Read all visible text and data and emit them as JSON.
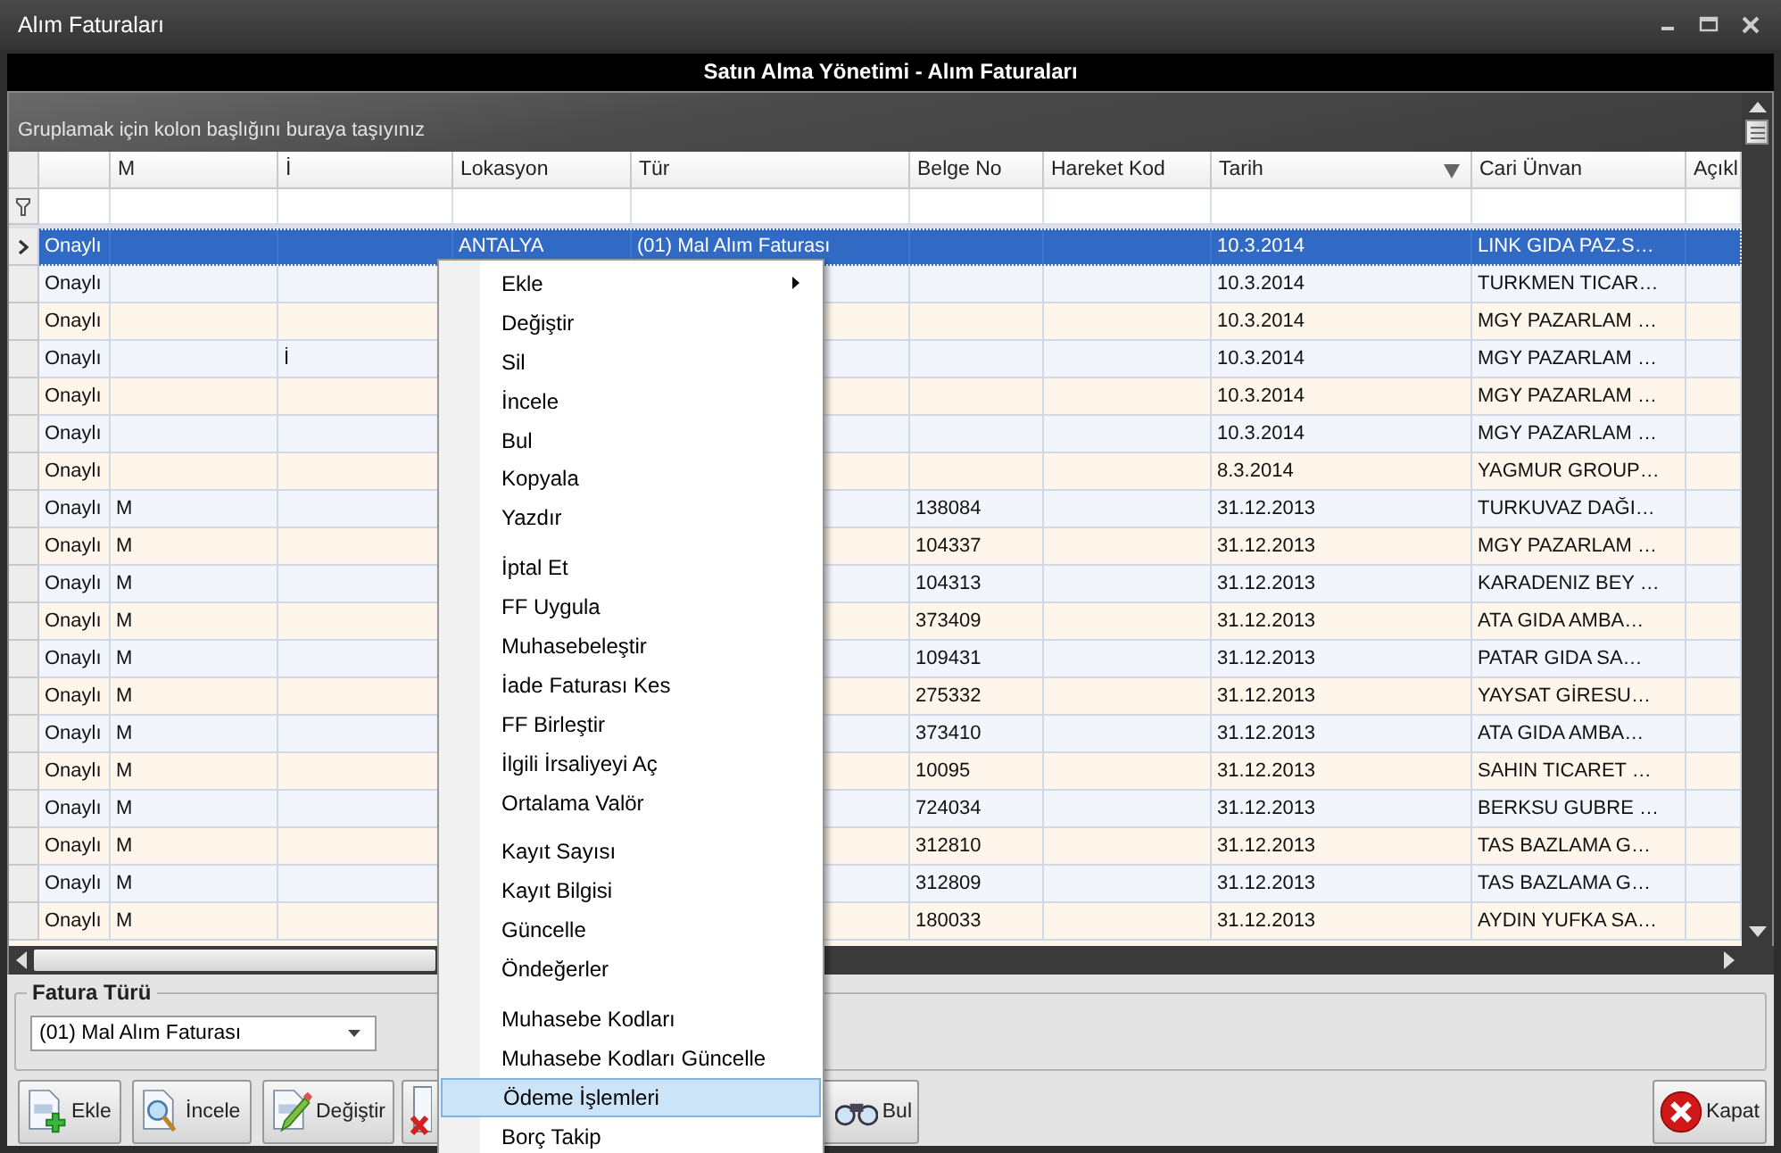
{
  "window": {
    "title": "Alım Faturaları"
  },
  "header_title": "Satın Alma Yönetimi - Alım Faturaları",
  "group_panel_hint": "Gruplamak için kolon başlığını buraya taşıyınız",
  "table": {
    "columns": [
      {
        "sorted": false
      },
      {
        "label": "M",
        "sorted": false
      },
      {
        "label": "İ",
        "sorted": false
      },
      {
        "label": "Lokasyon",
        "sorted": false
      },
      {
        "label": "Tür",
        "sorted": false
      },
      {
        "label": "Belge No",
        "sorted": false
      },
      {
        "label": "Hareket Kod",
        "sorted": false
      },
      {
        "label": "Tarih",
        "sorted": true
      },
      {
        "label": "Cari Ünvan",
        "sorted": false
      },
      {
        "label": "Açıkl",
        "sorted": false
      }
    ],
    "rows": [
      {
        "selected": true,
        "cells": [
          "Onaylı",
          "",
          "",
          "ANTALYA",
          "(01) Mal Alım Faturası",
          "",
          "",
          "10.3.2014",
          "LINK GIDA PAZ.S…"
        ]
      },
      {
        "selected": false,
        "cells": [
          "Onaylı",
          "",
          "",
          "",
          "",
          "",
          "",
          "10.3.2014",
          "TURKMEN TICAR…"
        ]
      },
      {
        "selected": false,
        "cells": [
          "Onaylı",
          "",
          "",
          "",
          "",
          "",
          "",
          "10.3.2014",
          "MGY PAZARLAM …"
        ]
      },
      {
        "selected": false,
        "cells": [
          "Onaylı",
          "",
          "İ",
          "",
          "",
          "",
          "",
          "10.3.2014",
          "MGY PAZARLAM …"
        ]
      },
      {
        "selected": false,
        "cells": [
          "Onaylı",
          "",
          "",
          "",
          "",
          "",
          "",
          "10.3.2014",
          "MGY PAZARLAM …"
        ]
      },
      {
        "selected": false,
        "cells": [
          "Onaylı",
          "",
          "",
          "",
          "",
          "",
          "",
          "10.3.2014",
          "MGY PAZARLAM …"
        ]
      },
      {
        "selected": false,
        "cells": [
          "Onaylı",
          "",
          "",
          "",
          "",
          "",
          "",
          "8.3.2014",
          "YAGMUR GROUP…"
        ]
      },
      {
        "selected": false,
        "cells": [
          "Onaylı",
          "M",
          "",
          "",
          "",
          "138084",
          "",
          "31.12.2013",
          "TURKUVAZ DAĞI…"
        ]
      },
      {
        "selected": false,
        "cells": [
          "Onaylı",
          "M",
          "",
          "",
          "",
          "104337",
          "",
          "31.12.2013",
          "MGY PAZARLAM …"
        ]
      },
      {
        "selected": false,
        "cells": [
          "Onaylı",
          "M",
          "",
          "",
          "",
          "104313",
          "",
          "31.12.2013",
          "KARADENIZ BEY …"
        ]
      },
      {
        "selected": false,
        "cells": [
          "Onaylı",
          "M",
          "",
          "",
          "",
          "373409",
          "",
          "31.12.2013",
          "ATA GIDA AMBA…"
        ]
      },
      {
        "selected": false,
        "cells": [
          "Onaylı",
          "M",
          "",
          "",
          "",
          "109431",
          "",
          "31.12.2013",
          "PATAR GIDA SA…"
        ]
      },
      {
        "selected": false,
        "cells": [
          "Onaylı",
          "M",
          "",
          "",
          "",
          "275332",
          "",
          "31.12.2013",
          "YAYSAT GİRESU…"
        ]
      },
      {
        "selected": false,
        "cells": [
          "Onaylı",
          "M",
          "",
          "",
          "",
          "373410",
          "",
          "31.12.2013",
          "ATA GIDA AMBA…"
        ]
      },
      {
        "selected": false,
        "cells": [
          "Onaylı",
          "M",
          "",
          "",
          "",
          "10095",
          "",
          "31.12.2013",
          "SAHIN TICARET …"
        ]
      },
      {
        "selected": false,
        "cells": [
          "Onaylı",
          "M",
          "",
          "",
          "",
          "724034",
          "",
          "31.12.2013",
          "BERKSU GUBRE …"
        ]
      },
      {
        "selected": false,
        "cells": [
          "Onaylı",
          "M",
          "",
          "",
          "",
          "312810",
          "",
          "31.12.2013",
          "TAS BAZLAMA G…"
        ]
      },
      {
        "selected": false,
        "cells": [
          "Onaylı",
          "M",
          "",
          "",
          "",
          "312809",
          "",
          "31.12.2013",
          "TAS BAZLAMA G…"
        ]
      },
      {
        "selected": false,
        "cells": [
          "Onaylı",
          "M",
          "",
          "",
          "",
          "180033",
          "",
          "31.12.2013",
          "AYDIN YUFKA SA…"
        ]
      }
    ]
  },
  "fatura_turu": {
    "label": "Fatura Türü",
    "value": "(01) Mal Alım Faturası"
  },
  "toolbar": {
    "left": [
      {
        "kind": "add",
        "label": "Ekle"
      },
      {
        "kind": "inspect",
        "label": "İncele"
      },
      {
        "kind": "edit",
        "label": "Değiştir"
      },
      {
        "kind": "delete"
      },
      {
        "kind": "find",
        "label": "Bul"
      }
    ],
    "right": [
      {
        "kind": "close",
        "label": "Kapat"
      }
    ]
  },
  "context_menu": [
    {
      "kind": "item",
      "label": "Ekle",
      "submenu": true,
      "selected": false
    },
    {
      "kind": "item",
      "label": "Değiştir",
      "submenu": false,
      "selected": false
    },
    {
      "kind": "item",
      "label": "Sil",
      "submenu": false,
      "selected": false
    },
    {
      "kind": "item",
      "label": "İncele",
      "submenu": false,
      "selected": false
    },
    {
      "kind": "item",
      "label": "Bul",
      "submenu": false,
      "selected": false
    },
    {
      "kind": "item",
      "label": "Kopyala",
      "submenu": false,
      "selected": false
    },
    {
      "kind": "item",
      "label": "Yazdır",
      "submenu": false,
      "selected": false
    },
    {
      "kind": "separator"
    },
    {
      "kind": "item",
      "label": "İptal Et",
      "submenu": false,
      "selected": false
    },
    {
      "kind": "item",
      "label": "FF Uygula",
      "submenu": false,
      "selected": false
    },
    {
      "kind": "item",
      "label": "Muhasebeleştir",
      "submenu": false,
      "selected": false
    },
    {
      "kind": "item",
      "label": "İade Faturası Kes",
      "submenu": false,
      "selected": false
    },
    {
      "kind": "item",
      "label": "FF Birleştir",
      "submenu": false,
      "selected": false
    },
    {
      "kind": "item",
      "label": "İlgili İrsaliyeyi Aç",
      "submenu": false,
      "selected": false
    },
    {
      "kind": "item",
      "label": "Ortalama Valör",
      "submenu": false,
      "selected": false
    },
    {
      "kind": "separator"
    },
    {
      "kind": "item",
      "label": "Kayıt Sayısı",
      "submenu": false,
      "selected": false
    },
    {
      "kind": "item",
      "label": "Kayıt Bilgisi",
      "submenu": false,
      "selected": false
    },
    {
      "kind": "item",
      "label": "Güncelle",
      "submenu": false,
      "selected": false
    },
    {
      "kind": "item",
      "label": "Öndeğerler",
      "submenu": false,
      "selected": false
    },
    {
      "kind": "separator"
    },
    {
      "kind": "item",
      "label": "Muhasebe Kodları",
      "submenu": false,
      "selected": false
    },
    {
      "kind": "item",
      "label": "Muhasebe Kodları Güncelle",
      "submenu": false,
      "selected": false
    },
    {
      "kind": "item",
      "label": "Ödeme İşlemleri",
      "submenu": false,
      "selected": true
    },
    {
      "kind": "item",
      "label": "Borç Takip",
      "submenu": false,
      "selected": false
    }
  ]
}
